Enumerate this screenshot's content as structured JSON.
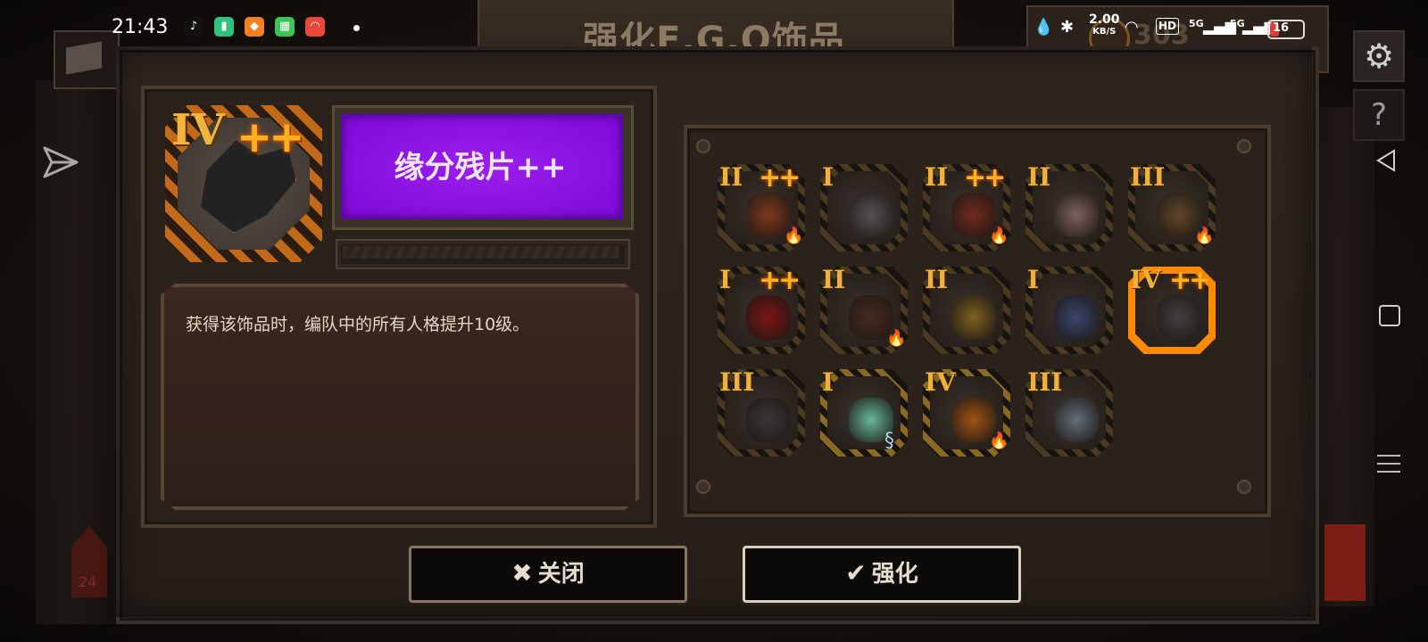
{
  "status_bar": {
    "time": "21:43",
    "net_speed": "2.00",
    "net_unit": "KB/S",
    "hd_label": "HD",
    "signal_1": "5G",
    "signal_2": "5G",
    "battery": "16"
  },
  "header": {
    "title": "强化E.G.O饰品",
    "coin_value": "303"
  },
  "selected_item": {
    "tier": "IV",
    "plus": "++",
    "name": "缘分残片++",
    "description": "获得该饰品时，编队中的所有人格提升10级。"
  },
  "grid": [
    {
      "tier": "II",
      "plus": "++",
      "fire": true,
      "swirl": false,
      "selected": false,
      "gold": false,
      "color": "#8c3a1a"
    },
    {
      "tier": "I",
      "plus": "",
      "fire": false,
      "swirl": false,
      "selected": false,
      "gold": false,
      "color": "#5a5a5a"
    },
    {
      "tier": "II",
      "plus": "++",
      "fire": true,
      "swirl": false,
      "selected": false,
      "gold": false,
      "color": "#7a2a1a"
    },
    {
      "tier": "II",
      "plus": "",
      "fire": false,
      "swirl": false,
      "selected": false,
      "gold": false,
      "color": "#8a6a6a"
    },
    {
      "tier": "III",
      "plus": "",
      "fire": true,
      "swirl": false,
      "selected": false,
      "gold": false,
      "color": "#6a4a2a"
    },
    {
      "tier": "I",
      "plus": "++",
      "fire": false,
      "swirl": false,
      "selected": false,
      "gold": false,
      "color": "#8a1010"
    },
    {
      "tier": "II",
      "plus": "",
      "fire": true,
      "swirl": false,
      "selected": false,
      "gold": false,
      "color": "#4a2a1a"
    },
    {
      "tier": "II",
      "plus": "",
      "fire": false,
      "swirl": false,
      "selected": false,
      "gold": false,
      "color": "#8a6a20"
    },
    {
      "tier": "I",
      "plus": "",
      "fire": false,
      "swirl": false,
      "selected": false,
      "gold": false,
      "color": "#3a4a7a"
    },
    {
      "tier": "IV",
      "plus": "++",
      "fire": false,
      "swirl": false,
      "selected": true,
      "gold": false,
      "color": "#444444"
    },
    {
      "tier": "III",
      "plus": "",
      "fire": false,
      "swirl": false,
      "selected": false,
      "gold": false,
      "color": "#3a3a3a"
    },
    {
      "tier": "I",
      "plus": "",
      "fire": false,
      "swirl": true,
      "selected": false,
      "gold": true,
      "color": "#6fd0a8"
    },
    {
      "tier": "IV",
      "plus": "",
      "fire": true,
      "swirl": false,
      "selected": false,
      "gold": true,
      "color": "#b25a10"
    },
    {
      "tier": "III",
      "plus": "",
      "fire": false,
      "swirl": false,
      "selected": false,
      "gold": false,
      "color": "#6a7a8a"
    }
  ],
  "buttons": {
    "close_label": "关闭",
    "confirm_label": "强化"
  },
  "colors": {
    "accent_orange": "#f0b13a",
    "name_purple": "#8a12e6",
    "selected_border": "#ff8a00"
  },
  "icons": {
    "settings": "gear-icon",
    "help": "help-icon",
    "share": "paper-plane-icon",
    "close": "close-icon",
    "confirm": "check-icon"
  }
}
